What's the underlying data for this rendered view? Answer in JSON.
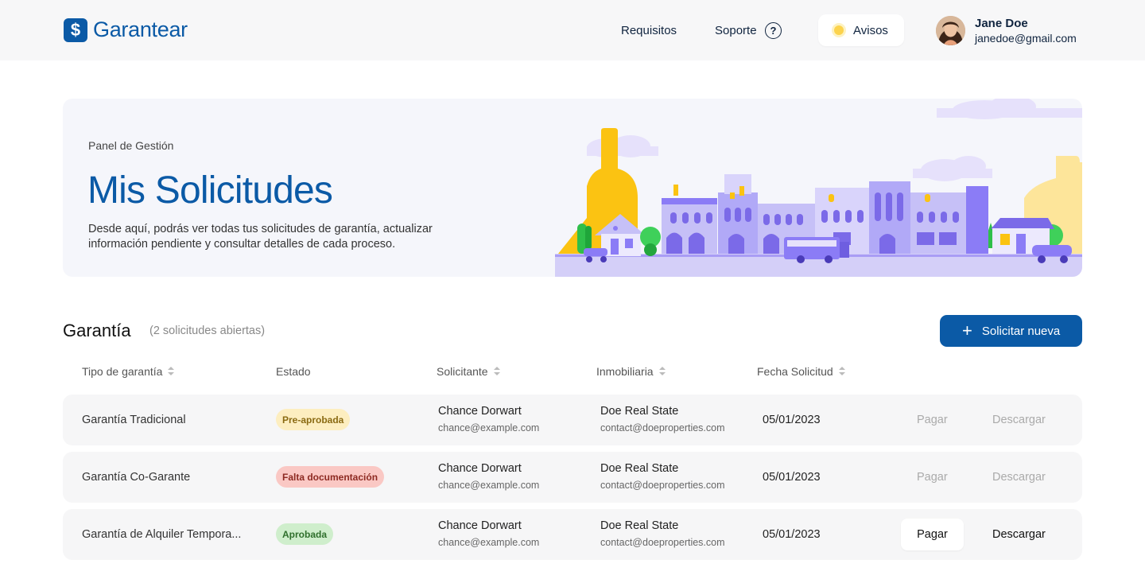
{
  "header": {
    "logo_symbol": "$",
    "brand": "Garantear",
    "nav": {
      "requisitos": "Requisitos",
      "soporte": "Soporte"
    },
    "help_symbol": "?",
    "avisos": "Avisos",
    "user": {
      "name": "Jane Doe",
      "email": "janedoe@gmail.com"
    }
  },
  "banner": {
    "breadcrumb": "Panel de Gestión",
    "title": "Mis Solicitudes",
    "description": "Desde aquí, podrás ver todas tus solicitudes de garantía, actualizar información pendiente y consultar detalles de cada proceso."
  },
  "section": {
    "title": "Garantía",
    "count": "(2 solicitudes abiertas)",
    "new_button_icon": "+",
    "new_button": "Solicitar nueva"
  },
  "table": {
    "columns": [
      "Tipo de garantía",
      "Estado",
      "Solicitante",
      "Inmobiliaria",
      "Fecha Solicitud"
    ],
    "rows": [
      {
        "tipo": "Garantía Tradicional",
        "estado": "Pre-aprobada",
        "solicitante": "Chance Dorwart",
        "solicitante_email": "chance@example.com",
        "inmobiliaria": "Doe Real State",
        "inmobiliaria_email": "contact@doeproperties.com",
        "fecha": "05/01/2023",
        "pagar": "Pagar",
        "descargar": "Descargar"
      },
      {
        "tipo": "Garantía Co-Garante",
        "estado": "Falta documentación",
        "solicitante": "Chance Dorwart",
        "solicitante_email": "chance@example.com",
        "inmobiliaria": "Doe Real State",
        "inmobiliaria_email": "contact@doeproperties.com",
        "fecha": "05/01/2023",
        "pagar": "Pagar",
        "descargar": "Descargar"
      },
      {
        "tipo": "Garantía de Alquiler Tempora...",
        "estado": "Aprobada",
        "solicitante": "Chance Dorwart",
        "solicitante_email": "chance@example.com",
        "inmobiliaria": "Doe Real State",
        "inmobiliaria_email": "contact@doeproperties.com",
        "fecha": "05/01/2023",
        "pagar": "Pagar",
        "descargar": "Descargar"
      }
    ]
  },
  "colors": {
    "brand": "#0b5aa6",
    "pre": "#fdeec0",
    "falta": "#fac8c4",
    "ok": "#cfeecc",
    "city_purple": "#8b7cf6",
    "city_yellow": "#fbc312"
  }
}
